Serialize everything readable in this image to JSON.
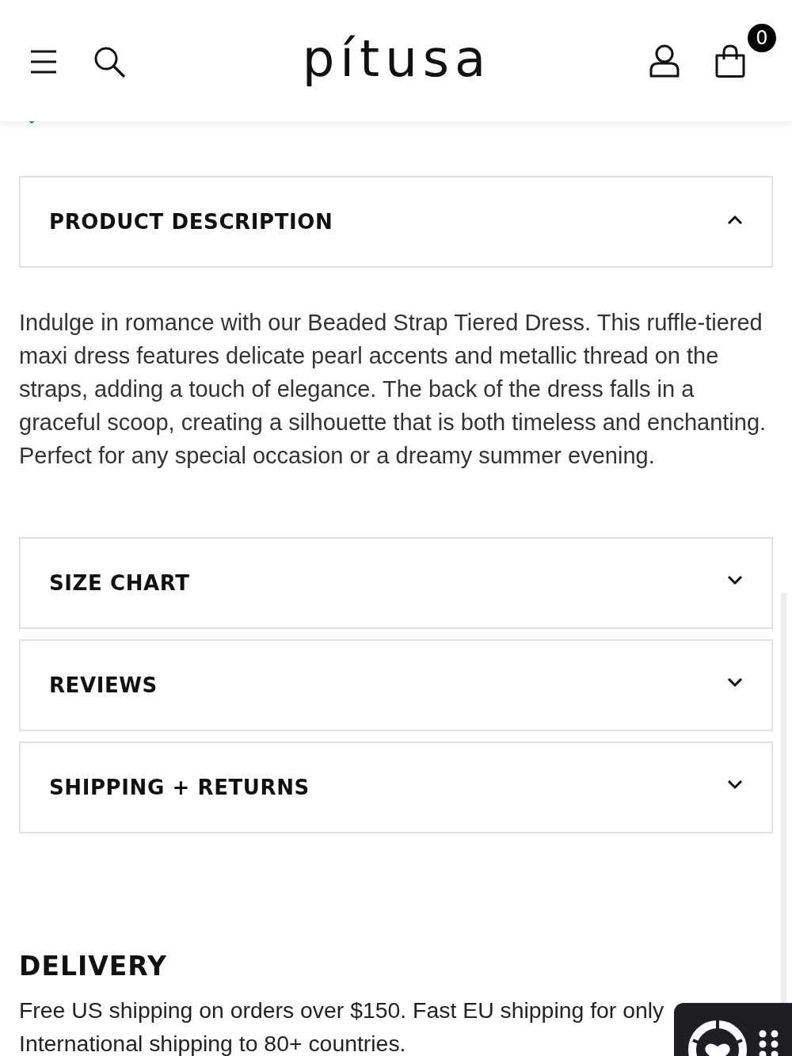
{
  "header": {
    "logo": "pítusa",
    "cart_count": "0"
  },
  "accordions": [
    {
      "title": "PRODUCT DESCRIPTION",
      "expanded": true,
      "body": "Indulge in romance with our Beaded Strap Tiered Dress. This ruffle-tiered maxi dress features delicate pearl accents and metallic thread on the straps, adding a touch of elegance. The back of the dress falls in a graceful scoop, creating a silhouette that is both timeless and enchanting. Perfect for any special occasion or a dreamy summer evening."
    },
    {
      "title": "SIZE CHART",
      "expanded": false
    },
    {
      "title": "REVIEWS",
      "expanded": false
    },
    {
      "title": "SHIPPING + RETURNS",
      "expanded": false
    }
  ],
  "delivery": {
    "title": "DELIVERY",
    "lines": [
      "Free US shipping on orders over $150. Fast EU shipping for only",
      "International shipping to 80+ countries."
    ]
  }
}
